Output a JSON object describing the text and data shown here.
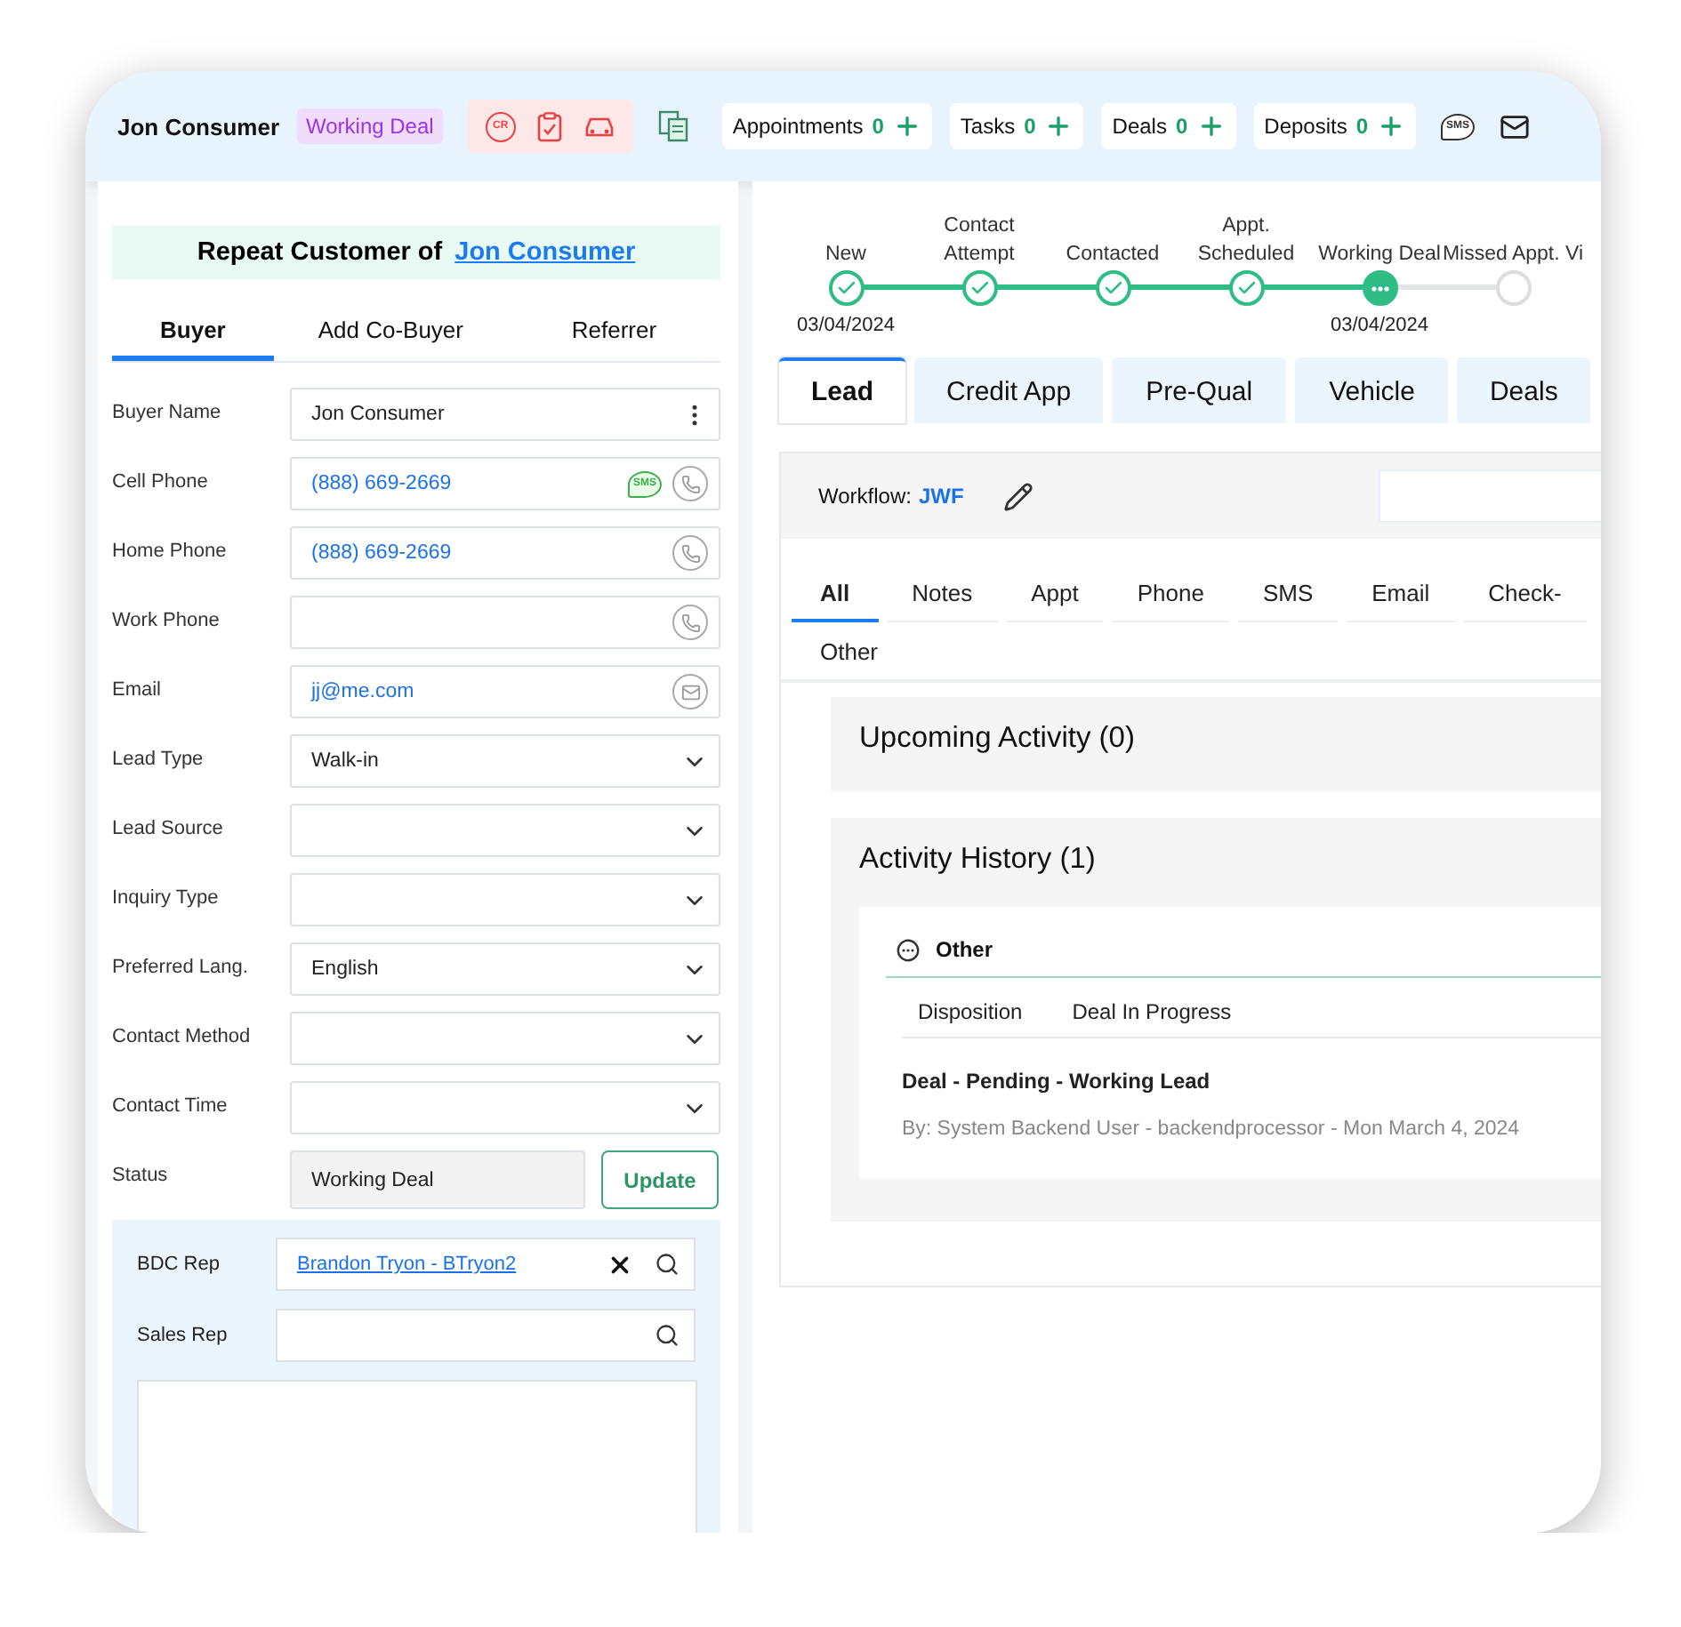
{
  "header": {
    "name": "Jon Consumer",
    "status_badge": "Working Deal",
    "cr_icon_text": "CR",
    "sms_icon_text": "SMS",
    "counters": [
      {
        "label": "Appointments",
        "count": "0"
      },
      {
        "label": "Tasks",
        "count": "0"
      },
      {
        "label": "Deals",
        "count": "0"
      },
      {
        "label": "Deposits",
        "count": "0"
      }
    ]
  },
  "left": {
    "banner": {
      "prefix": "Repeat Customer of",
      "link": "Jon Consumer"
    },
    "tabs": [
      {
        "label": "Buyer",
        "selected": true
      },
      {
        "label": "Add Co-Buyer",
        "selected": false
      },
      {
        "label": "Referrer",
        "selected": false
      }
    ],
    "fields": [
      {
        "label": "Buyer Name",
        "kind": "name",
        "value": "Jon Consumer"
      },
      {
        "label": "Cell Phone",
        "kind": "phone",
        "value": "(888) 669-2669",
        "sms": true,
        "sms_text": "SMS"
      },
      {
        "label": "Home Phone",
        "kind": "phone",
        "value": "(888) 669-2669",
        "sms": false
      },
      {
        "label": "Work Phone",
        "kind": "phone",
        "sms": false
      },
      {
        "label": "Email",
        "kind": "email",
        "value": "jj@me.com"
      },
      {
        "label": "Lead Type",
        "kind": "select",
        "value": "Walk-in"
      },
      {
        "label": "Lead Source",
        "kind": "select"
      },
      {
        "label": "Inquiry Type",
        "kind": "select"
      },
      {
        "label": "Preferred Lang.",
        "kind": "select",
        "value": "English"
      },
      {
        "label": "Contact Method",
        "kind": "select"
      },
      {
        "label": "Contact Time",
        "kind": "select"
      }
    ],
    "status": {
      "label": "Status",
      "value": "Working Deal",
      "button": "Update"
    },
    "reps": [
      {
        "label": "BDC Rep",
        "value": "Brandon Tryon - BTryon2",
        "clearable": true
      },
      {
        "label": "Sales Rep",
        "clearable": false
      }
    ]
  },
  "stepper": {
    "steps": [
      {
        "label": "New",
        "date": "03/04/2024",
        "completed": true,
        "current": false
      },
      {
        "label": "Contact\nAttempt",
        "completed": true,
        "current": false
      },
      {
        "label": "Contacted",
        "completed": true,
        "current": false
      },
      {
        "label": "Appt.\nScheduled",
        "completed": true,
        "current": false
      },
      {
        "label": "Working Deal",
        "date": "03/04/2024",
        "completed": false,
        "current": true
      },
      {
        "label": "Missed Appt. Vi",
        "completed": false,
        "current": false
      }
    ]
  },
  "tabs": [
    {
      "label": "Lead",
      "selected": true
    },
    {
      "label": "Credit App",
      "selected": false
    },
    {
      "label": "Pre-Qual",
      "selected": false
    },
    {
      "label": "Vehicle",
      "selected": false
    },
    {
      "label": "Deals",
      "selected": false
    }
  ],
  "workflow": {
    "label": "Workflow:",
    "value": "JWF"
  },
  "activity_tabs": [
    {
      "label": "All",
      "selected": true
    },
    {
      "label": "Notes",
      "selected": false
    },
    {
      "label": "Appt",
      "selected": false
    },
    {
      "label": "Phone",
      "selected": false
    },
    {
      "label": "SMS",
      "selected": false
    },
    {
      "label": "Email",
      "selected": false
    },
    {
      "label": "Check-",
      "selected": false
    },
    {
      "label": "Other",
      "selected": false
    }
  ],
  "upcoming": {
    "title": "Upcoming Activity (0)"
  },
  "history": {
    "title": "Activity History (1)",
    "entry": {
      "type": "Other",
      "disposition_label": "Disposition",
      "disposition_value": "Deal In Progress",
      "summary": "Deal - Pending - Working Lead",
      "byline": "By: System Backend User - backendprocessor - Mon March 4, 2024"
    }
  }
}
